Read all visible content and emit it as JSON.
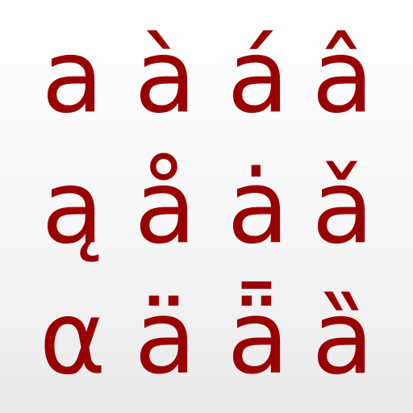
{
  "theme": {
    "glyph_color": "#990000",
    "background_top": "#ffffff",
    "background_bottom": "#e9e9e9"
  },
  "rows": [
    {
      "glyphs": [
        "a",
        "à",
        "á",
        "â"
      ]
    },
    {
      "glyphs": [
        "ą",
        "å",
        "ȧ",
        "ǎ"
      ]
    },
    {
      "glyphs": [
        "α",
        "ä",
        "ǟ",
        "ȁ"
      ]
    }
  ]
}
